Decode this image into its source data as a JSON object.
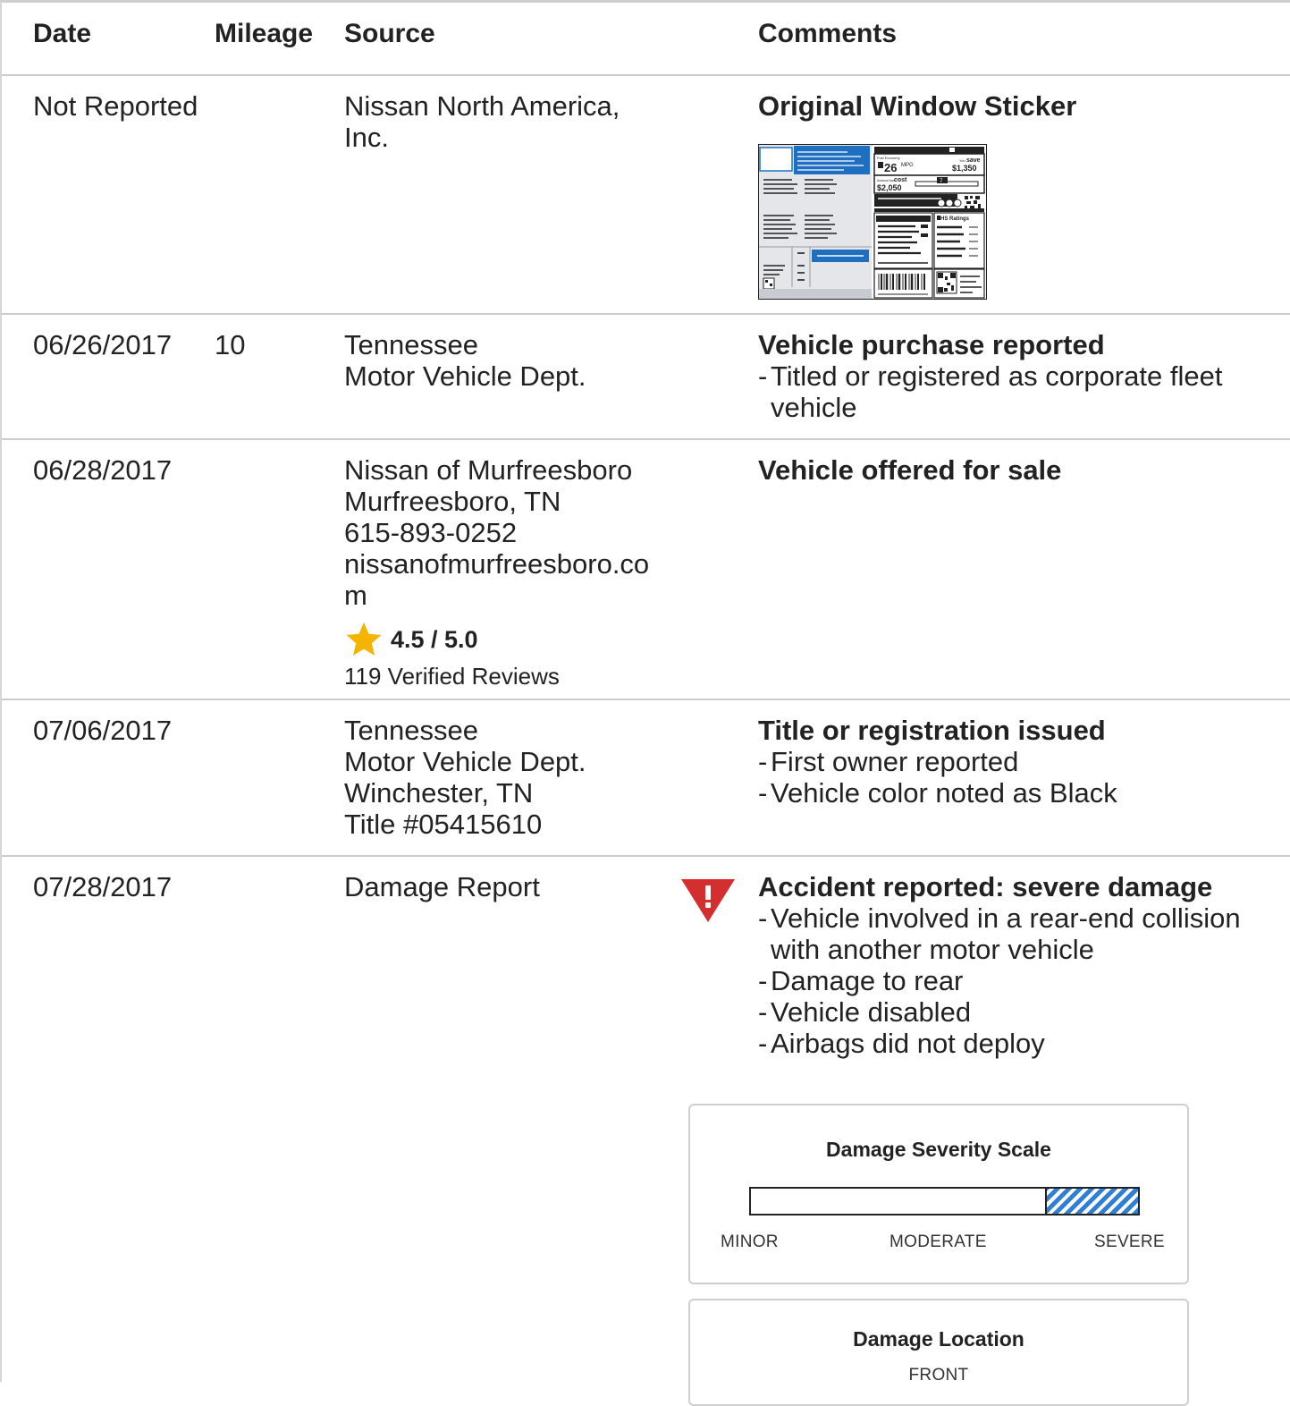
{
  "columns": {
    "date": "Date",
    "mileage": "Mileage",
    "source": "Source",
    "comments": "Comments"
  },
  "rows": [
    {
      "date": "Not Reported",
      "mileage": "",
      "source": [
        "Nissan North America,",
        "Inc."
      ],
      "title": "Original Window Sticker",
      "sticker": {
        "mpg": "26",
        "mpg_unit": "MPG",
        "you_save": "save",
        "save_amount": "$1,350",
        "annual_cost_label": "cost",
        "annual_cost": "$2,050",
        "rating": "7",
        "safety_label": "HS Ratings"
      }
    },
    {
      "date": "06/26/2017",
      "mileage": "10",
      "source": [
        "Tennessee",
        "Motor Vehicle Dept."
      ],
      "title": "Vehicle purchase reported",
      "bullets": [
        "Titled or registered as corporate fleet vehicle"
      ]
    },
    {
      "date": "06/28/2017",
      "mileage": "",
      "source": [
        "Nissan of Murfreesboro",
        "Murfreesboro, TN",
        "615-893-0252",
        "nissanofmurfreesboro.co",
        "m"
      ],
      "rating": "4.5 / 5.0",
      "rating_value": 4.5,
      "reviews": "119 Verified Reviews",
      "title": "Vehicle offered for sale"
    },
    {
      "date": "07/06/2017",
      "mileage": "",
      "source": [
        "Tennessee",
        "Motor Vehicle Dept.",
        "Winchester, TN",
        "Title #05415610"
      ],
      "title": "Title or registration issued",
      "bullets": [
        "First owner reported",
        "Vehicle color noted as Black"
      ]
    },
    {
      "date": "07/28/2017",
      "mileage": "",
      "source": [
        "Damage Report"
      ],
      "title": "Accident reported: severe damage",
      "bullets": [
        "Vehicle involved in a rear-end collision with another motor vehicle",
        "Damage to rear",
        "Vehicle disabled",
        "Airbags did not deploy"
      ]
    }
  ],
  "severity_panel": {
    "title": "Damage Severity Scale",
    "labels": [
      "MINOR",
      "MODERATE",
      "SEVERE"
    ],
    "level_fraction_start": 0.76,
    "fill_color": "#2f7fd6"
  },
  "location_panel": {
    "title": "Damage Location",
    "front_label": "FRONT"
  },
  "colors": {
    "warning": "#d32f2f",
    "star": "#f4b400",
    "accent_blue": "#1f6fc1",
    "divider": "#cccccc"
  },
  "icons": {
    "warning": "warning-triangle-icon",
    "star": "star-icon"
  }
}
